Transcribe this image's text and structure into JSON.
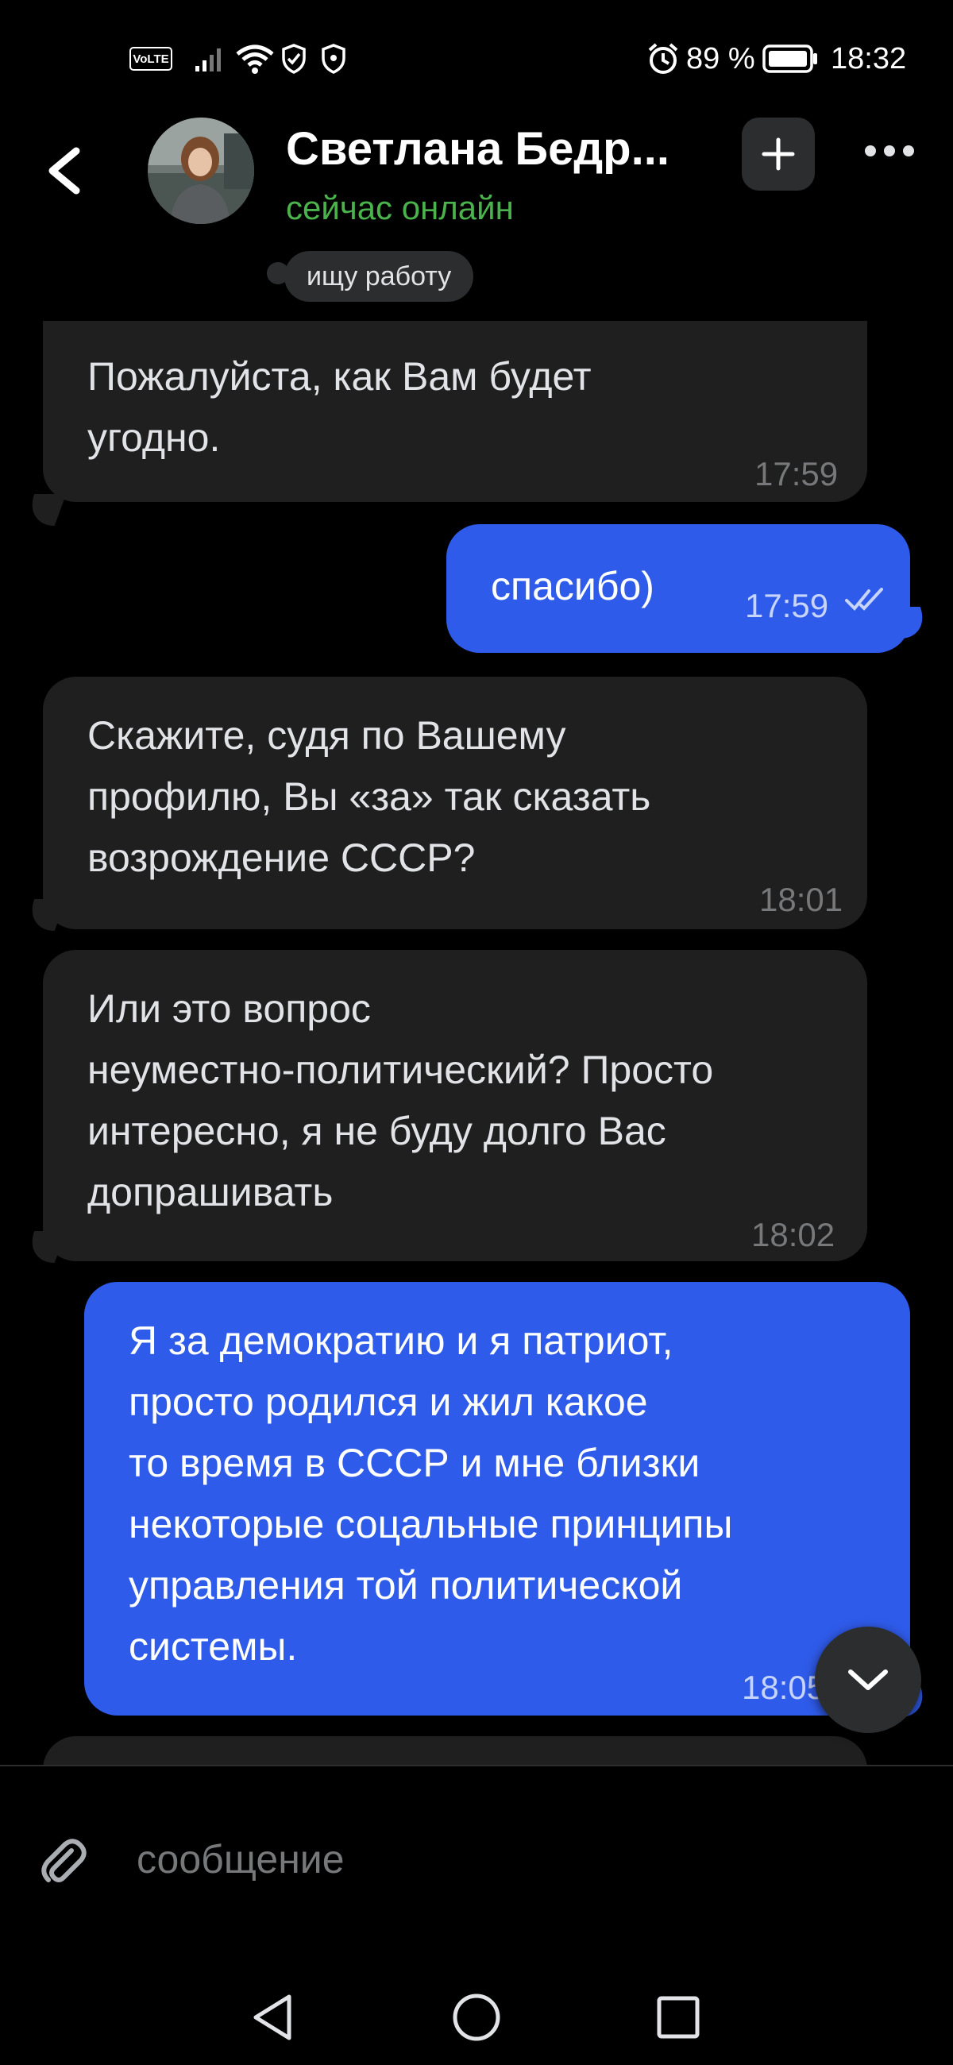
{
  "status_bar": {
    "volte": "VoLTE",
    "battery_percent": "89 %",
    "time": "18:32"
  },
  "header": {
    "contact_name": "Светлана Бедр...",
    "contact_status": "сейчас онлайн",
    "status_chip": "ищу работу"
  },
  "messages": [
    {
      "direction": "in",
      "text_lines": [
        "Пожалуйста, как Вам будет",
        "угодно."
      ],
      "time": "17:59"
    },
    {
      "direction": "out",
      "text_lines": [
        "спасибо)"
      ],
      "time": "17:59",
      "read": true
    },
    {
      "direction": "in",
      "text_lines": [
        "Скажите, судя по Вашему",
        "профилю, Вы «за» так сказать",
        "возрождение СССР?"
      ],
      "time": "18:01"
    },
    {
      "direction": "in",
      "text_lines": [
        "Или это вопрос",
        "неуместно-политический? Просто",
        "интересно, я не буду долго Вас",
        "допрашивать"
      ],
      "time": "18:02"
    },
    {
      "direction": "out",
      "text_lines": [
        "Я за демократию и я патриот,",
        "просто родился и жил какое",
        "то время в СССР и мне близки",
        "некоторые соцальные принципы",
        "управления той политической",
        "системы."
      ],
      "time": "18:05"
    }
  ],
  "composer": {
    "placeholder": "сообщение"
  },
  "colors": {
    "background": "#000000",
    "incoming_bubble": "#1f1f20",
    "outgoing_bubble": "#2f5bea",
    "online_green": "#4bb34b"
  },
  "icons": [
    "back-arrow-icon",
    "plus-icon",
    "more-icon",
    "chevron-down-icon",
    "paperclip-icon",
    "nav-back-icon",
    "nav-home-icon",
    "nav-recents-icon"
  ]
}
